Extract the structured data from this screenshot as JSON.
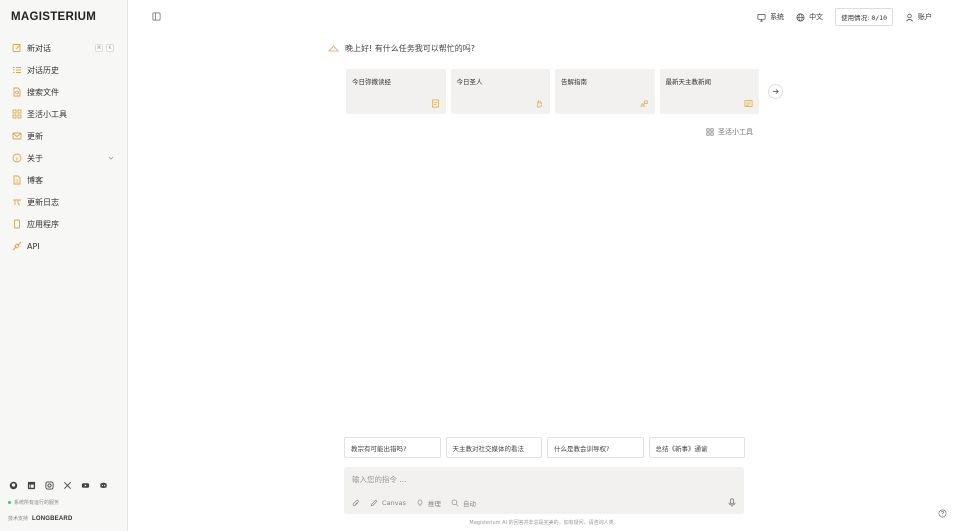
{
  "brand": "MAGISTERIUM",
  "sidebar": {
    "items": [
      {
        "label": "新对话",
        "icon": "new-chat-icon"
      },
      {
        "label": "对话历史",
        "icon": "history-icon"
      },
      {
        "label": "搜索文件",
        "icon": "search-files-icon"
      },
      {
        "label": "圣活小工具",
        "icon": "tools-grid-icon"
      },
      {
        "label": "更新",
        "icon": "mail-icon"
      },
      {
        "label": "关于",
        "icon": "info-icon"
      },
      {
        "label": "博客",
        "icon": "document-icon"
      },
      {
        "label": "更新日志",
        "icon": "changelog-icon"
      },
      {
        "label": "应用程序",
        "icon": "phone-icon"
      },
      {
        "label": "API",
        "icon": "api-icon"
      }
    ],
    "shortcut": [
      "⌘",
      "K"
    ],
    "socials": [
      "github-icon",
      "linkedin-icon",
      "instagram-icon",
      "x-icon",
      "youtube-icon",
      "discord-icon"
    ],
    "status_text": "系统所有运行的服务",
    "powered_prefix": "技术支持",
    "powered_brand": "LONGBEARD"
  },
  "topbar": {
    "system_label": "系统",
    "language_label": "中文",
    "usage_label": "使用情况:",
    "usage_value": "0/10",
    "account_label": "账户"
  },
  "main": {
    "greeting": "晚上好!  有什么任务我可以帮忙的吗?",
    "cards": [
      {
        "title": "今日弥撒读经",
        "icon": "book-icon"
      },
      {
        "title": "今日圣人",
        "icon": "hand-icon"
      },
      {
        "title": "告解指南",
        "icon": "thumbs-icon"
      },
      {
        "title": "最新天主教新闻",
        "icon": "news-icon"
      }
    ],
    "tools_link": "圣活小工具",
    "suggestions": [
      "教宗有可能出错吗?",
      "天主教对社交媒体的看法",
      "什么是教会训导权?",
      "总结《新事》通谕"
    ],
    "input_placeholder": "输入您的指令 ...",
    "composer_tools": [
      {
        "label": "Canvas",
        "icon": "pen-icon"
      },
      {
        "label": "推理",
        "icon": "bulb-icon"
      },
      {
        "label": "自动",
        "icon": "search-icon"
      }
    ],
    "disclaimer": "Magisterium AI 的回答并非总是完美的。如有疑问，请咨询人类。"
  }
}
